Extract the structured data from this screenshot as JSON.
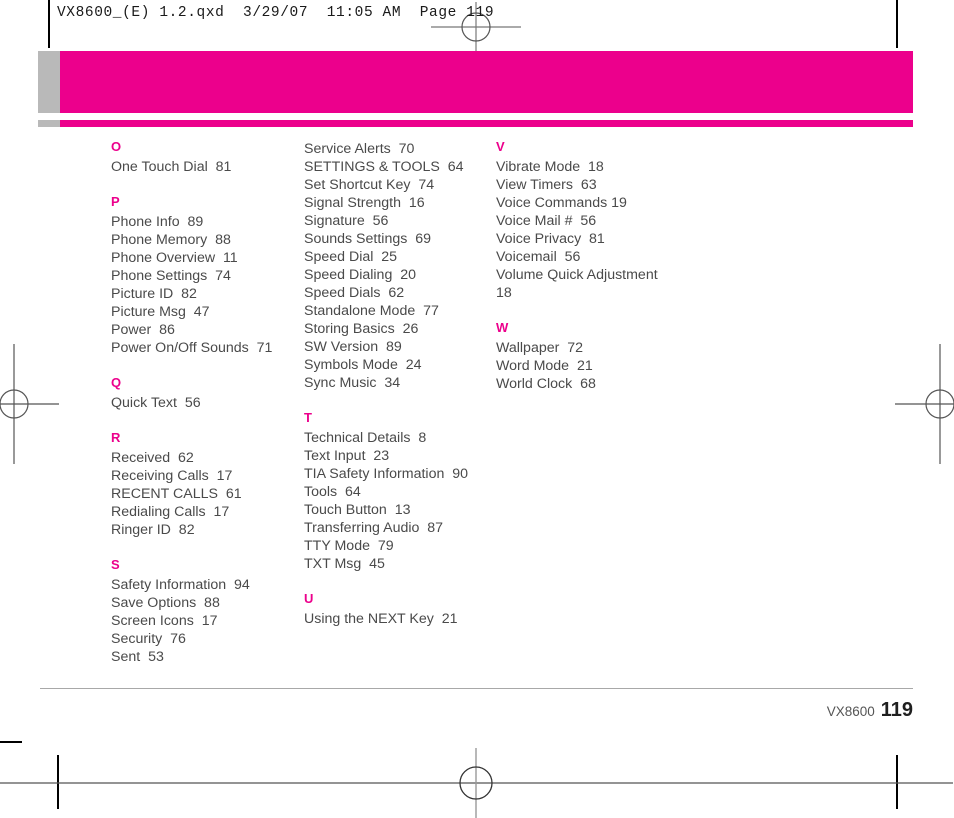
{
  "prepress": {
    "slug": "VX8600_(E) 1.2.qxd  3/29/07  11:05 AM  Page 119",
    "reg_mark_top": "registration-mark",
    "reg_mark_left": "registration-mark",
    "reg_mark_right": "registration-mark",
    "reg_mark_bottom": "registration-mark"
  },
  "banner": {
    "accent_color": "#ec008c",
    "tab_color": "#b9b9b9"
  },
  "index": {
    "columns": [
      {
        "groups": [
          {
            "letter": "O",
            "entries": [
              "One Touch Dial  81"
            ]
          },
          {
            "letter": "P",
            "entries": [
              "Phone Info  89",
              "Phone Memory  88",
              "Phone Overview  11",
              "Phone Settings  74",
              "Picture ID  82",
              "Picture Msg  47",
              "Power  86",
              "Power On/Off Sounds  71"
            ]
          },
          {
            "letter": "Q",
            "entries": [
              "Quick Text  56"
            ]
          },
          {
            "letter": "R",
            "entries": [
              "Received  62",
              "Receiving Calls  17",
              "RECENT CALLS  61",
              "Redialing Calls  17",
              "Ringer ID  82"
            ]
          },
          {
            "letter": "S",
            "entries": [
              "Safety Information  94",
              "Save Options  88",
              "Screen Icons  17",
              "Security  76",
              "Sent  53"
            ]
          }
        ]
      },
      {
        "groups": [
          {
            "letter": "",
            "entries": [
              "Service Alerts  70",
              "SETTINGS & TOOLS  64",
              "Set Shortcut Key  74",
              "Signal Strength  16",
              "Signature  56",
              "Sounds Settings  69",
              "Speed Dial  25",
              "Speed Dialing  20",
              "Speed Dials  62",
              "Standalone Mode  77",
              "Storing Basics  26",
              "SW Version  89",
              "Symbols Mode  24",
              "Sync Music  34"
            ]
          },
          {
            "letter": "T",
            "entries": [
              "Technical Details  8",
              "Text Input  23",
              "TIA Safety Information  90",
              "Tools  64",
              "Touch Button  13",
              "Transferring Audio  87",
              "TTY Mode  79",
              "TXT Msg  45"
            ]
          },
          {
            "letter": "U",
            "entries": [
              "Using the NEXT Key  21"
            ]
          }
        ]
      },
      {
        "groups": [
          {
            "letter": "V",
            "entries": [
              "Vibrate Mode  18",
              "View Timers  63",
              "Voice Commands 19",
              "Voice Mail #  56",
              "Voice Privacy  81",
              "Voicemail  56",
              "Volume Quick Adjustment\n18"
            ]
          },
          {
            "letter": "W",
            "entries": [
              "Wallpaper  72",
              "Word Mode  21",
              "World Clock  68"
            ]
          }
        ]
      }
    ]
  },
  "footer": {
    "model": "VX8600",
    "page_number": "119"
  }
}
